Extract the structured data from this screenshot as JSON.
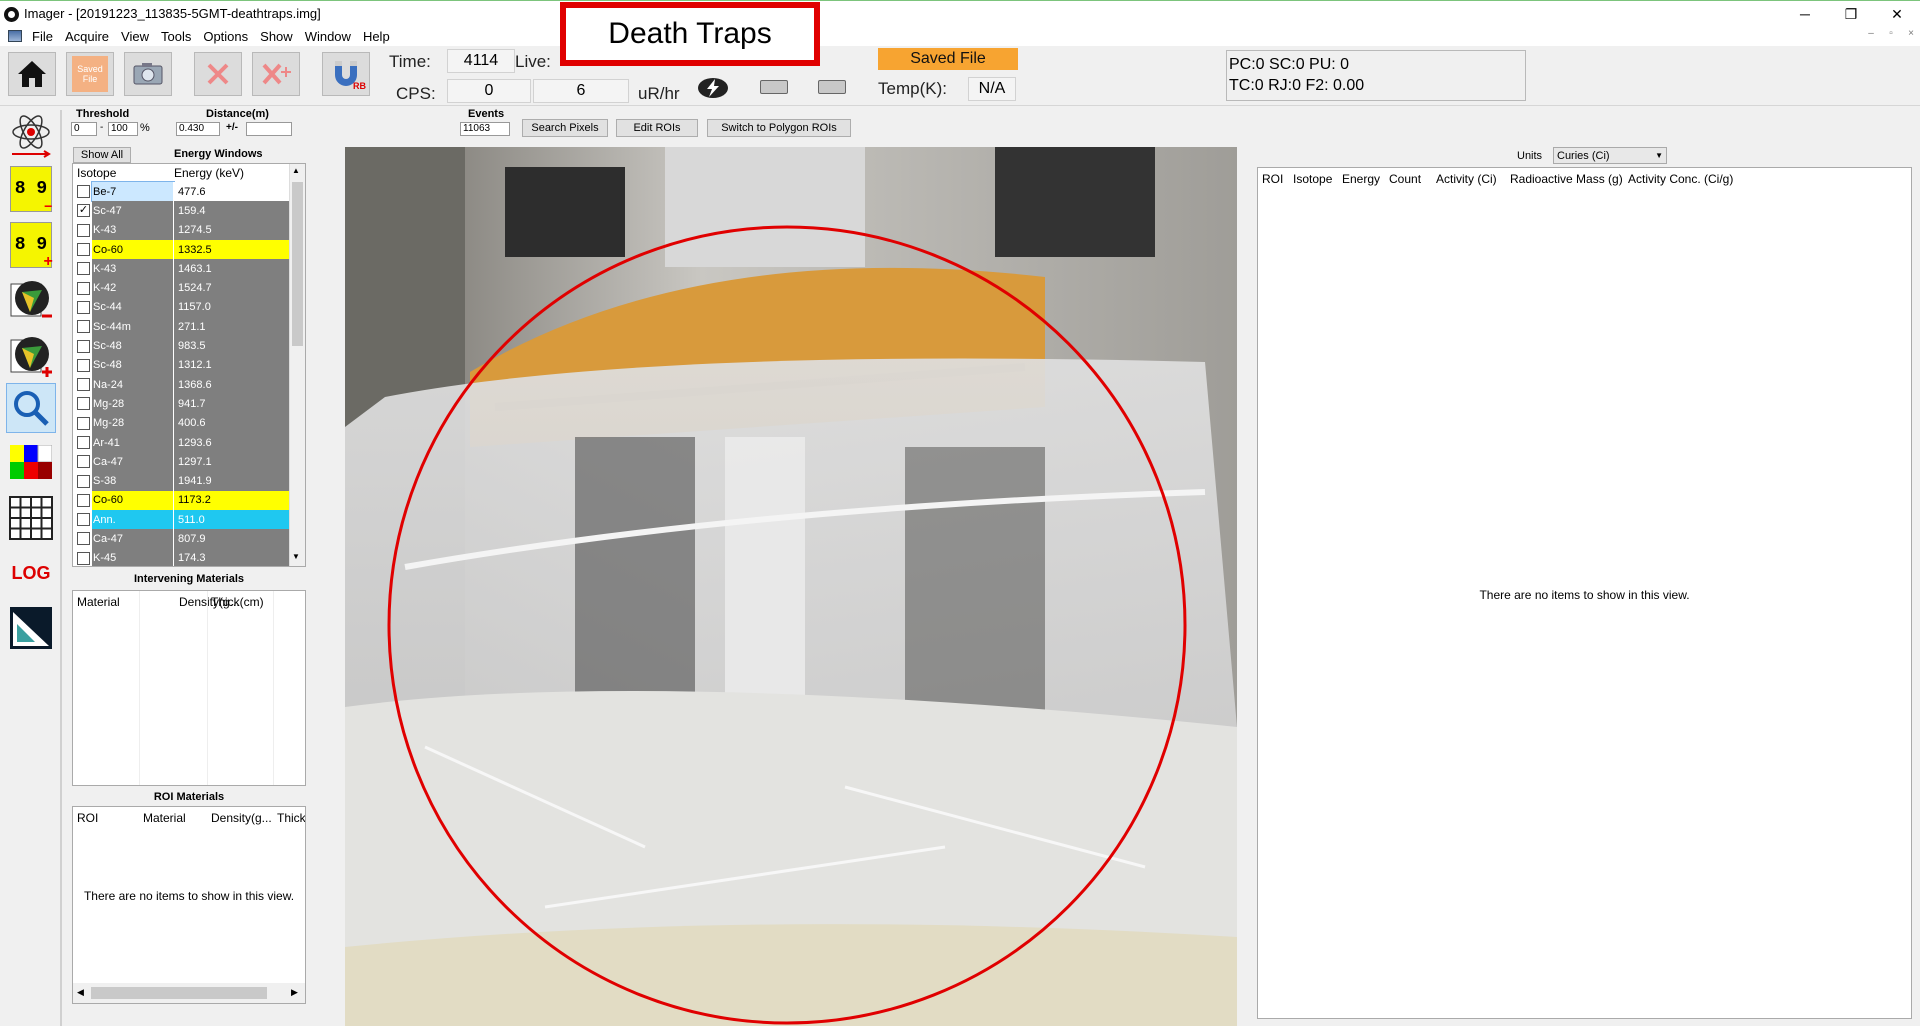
{
  "window": {
    "title": "Imager - [20191223_113835-5GMT-deathtraps.img]",
    "minimize": "─",
    "restore": "❐",
    "close": "✕",
    "mdi_min": "–",
    "mdi_restore": "▫",
    "mdi_close": "×"
  },
  "menu": [
    "File",
    "Acquire",
    "View",
    "Tools",
    "Options",
    "Show",
    "Window",
    "Help"
  ],
  "toolbar": {
    "saved_file_btn": "Saved\nFile",
    "rb_label": "RB",
    "time_label": "Time:",
    "time_value": "4114",
    "live_label": "Live:",
    "cps_label": "CPS:",
    "cps_value": "0",
    "dose_value": "6",
    "dose_unit": "uR/hr",
    "saved_badge": "Saved File",
    "temp_label": "Temp(K):",
    "temp_value": "N/A",
    "status_line1": "PC:0 SC:0 PU: 0",
    "status_line2": "TC:0 RJ:0  F2: 0.00"
  },
  "annotation": "Death Traps",
  "side_icons": {
    "ruler_digits": "8 9",
    "ruler_minus": "–",
    "ruler_plus": "+",
    "log": "LOG"
  },
  "controls": {
    "threshold_label": "Threshold",
    "threshold_min": "0",
    "threshold_dash": "-",
    "threshold_max": "100",
    "threshold_unit": "%",
    "distance_label": "Distance(m)",
    "distance_value": "0.430",
    "distance_pm": "+/-",
    "distance_pm_value": "",
    "events_label": "Events",
    "events_value": "11063",
    "search_pixels": "Search Pixels",
    "edit_rois": "Edit ROIs",
    "switch_polygon": "Switch to Polygon ROIs",
    "show_all": "Show All",
    "energy_windows": "Energy Windows"
  },
  "isotope_table": {
    "headers": [
      "Isotope",
      "Energy (keV)"
    ],
    "rows": [
      {
        "name": "Be-7",
        "energy": "477.6",
        "checked": false,
        "style": "selected"
      },
      {
        "name": "Sc-47",
        "energy": "159.4",
        "checked": true,
        "style": "gray"
      },
      {
        "name": "K-43",
        "energy": "1274.5",
        "checked": false,
        "style": "gray"
      },
      {
        "name": "Co-60",
        "energy": "1332.5",
        "checked": false,
        "style": "yellow"
      },
      {
        "name": "K-43",
        "energy": "1463.1",
        "checked": false,
        "style": "gray"
      },
      {
        "name": "K-42",
        "energy": "1524.7",
        "checked": false,
        "style": "gray"
      },
      {
        "name": "Sc-44",
        "energy": "1157.0",
        "checked": false,
        "style": "gray"
      },
      {
        "name": "Sc-44m",
        "energy": "271.1",
        "checked": false,
        "style": "gray"
      },
      {
        "name": "Sc-48",
        "energy": "983.5",
        "checked": false,
        "style": "gray"
      },
      {
        "name": "Sc-48",
        "energy": "1312.1",
        "checked": false,
        "style": "gray"
      },
      {
        "name": "Na-24",
        "energy": "1368.6",
        "checked": false,
        "style": "gray"
      },
      {
        "name": "Mg-28",
        "energy": "941.7",
        "checked": false,
        "style": "gray"
      },
      {
        "name": "Mg-28",
        "energy": "400.6",
        "checked": false,
        "style": "gray"
      },
      {
        "name": "Ar-41",
        "energy": "1293.6",
        "checked": false,
        "style": "gray"
      },
      {
        "name": "Ca-47",
        "energy": "1297.1",
        "checked": false,
        "style": "gray"
      },
      {
        "name": "S-38",
        "energy": "1941.9",
        "checked": false,
        "style": "gray"
      },
      {
        "name": "Co-60",
        "energy": "1173.2",
        "checked": false,
        "style": "yellow"
      },
      {
        "name": "Ann.",
        "energy": "511.0",
        "checked": false,
        "style": "cyan"
      },
      {
        "name": "Ca-47",
        "energy": "807.9",
        "checked": false,
        "style": "gray"
      },
      {
        "name": "K-45",
        "energy": "174.3",
        "checked": false,
        "style": "gray"
      }
    ]
  },
  "intervening": {
    "title": "Intervening Materials",
    "headers": [
      "Material",
      "Density(g...",
      "Thick(cm)"
    ]
  },
  "roi_materials": {
    "title": "ROI Materials",
    "headers": [
      "ROI",
      "Material",
      "Density(g...",
      "Thick"
    ],
    "empty": "There are no items to show in this view."
  },
  "results": {
    "units_label": "Units",
    "units_value": "Curies (Ci)",
    "headers": [
      "ROI",
      "Isotope",
      "Energy",
      "Count",
      "Activity (Ci)",
      "Radioactive Mass (g)",
      "Activity Conc. (Ci/g)"
    ],
    "empty": "There are no items to show in this view."
  },
  "colors": {
    "row_gray": "#7f7f7f",
    "row_yellow": "#ffff00",
    "row_cyan": "#1fc8f0",
    "row_selected": "#cce8ff",
    "annotation_red": "#e00000",
    "roi_circle": "#e00000",
    "saved_orange": "#f7a431"
  }
}
